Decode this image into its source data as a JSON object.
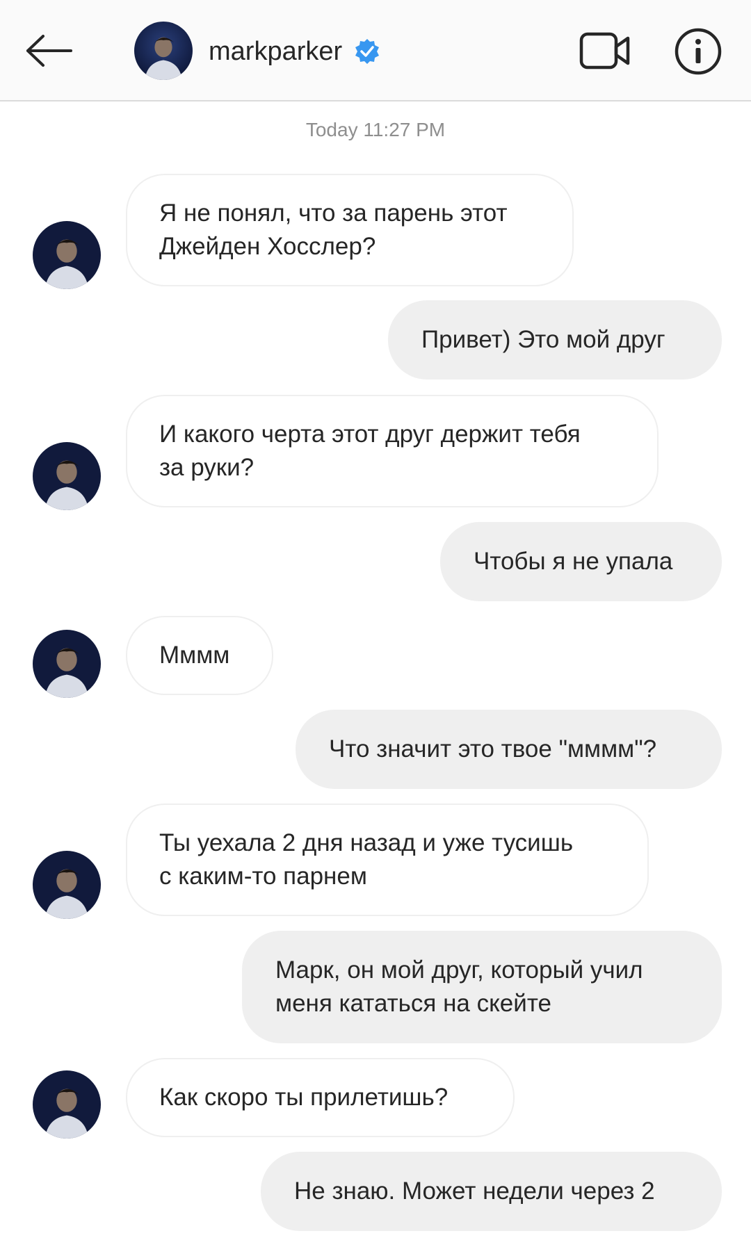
{
  "header": {
    "username": "markparker",
    "back_icon": "arrow-left-icon",
    "verified_icon": "verified-badge-icon",
    "video_icon": "video-camera-icon",
    "info_icon": "info-circle-icon"
  },
  "conversation": {
    "timestamp": "Today 11:27 PM",
    "messages": [
      {
        "from": "markparker",
        "text": "Я не понял, что за парень этот\nДжейден Хосслер?"
      },
      {
        "from": "me",
        "text": "Привет) Это мой друг"
      },
      {
        "from": "markparker",
        "text": "И какого черта этот друг держит тебя\nза руки?"
      },
      {
        "from": "me",
        "text": "Чтобы я не упала"
      },
      {
        "from": "markparker",
        "text": "Мммм"
      },
      {
        "from": "me",
        "text": "Что значит это твое \"мммм\"?"
      },
      {
        "from": "markparker",
        "text": "Ты уехала 2 дня назад и уже тусишь\nс каким-то парнем"
      },
      {
        "from": "me",
        "text": "Марк, он мой друг, который учил\nменя кататься на скейте"
      },
      {
        "from": "markparker",
        "text": "Как скоро ты прилетишь?"
      },
      {
        "from": "me",
        "text": "Не знаю. Может недели через 2"
      }
    ]
  },
  "colors": {
    "header_bg": "#fafafa",
    "sent_bubble": "#efefef",
    "received_border": "#efefef",
    "verified_blue": "#3897f0",
    "timestamp_text": "#8e8e8e"
  }
}
